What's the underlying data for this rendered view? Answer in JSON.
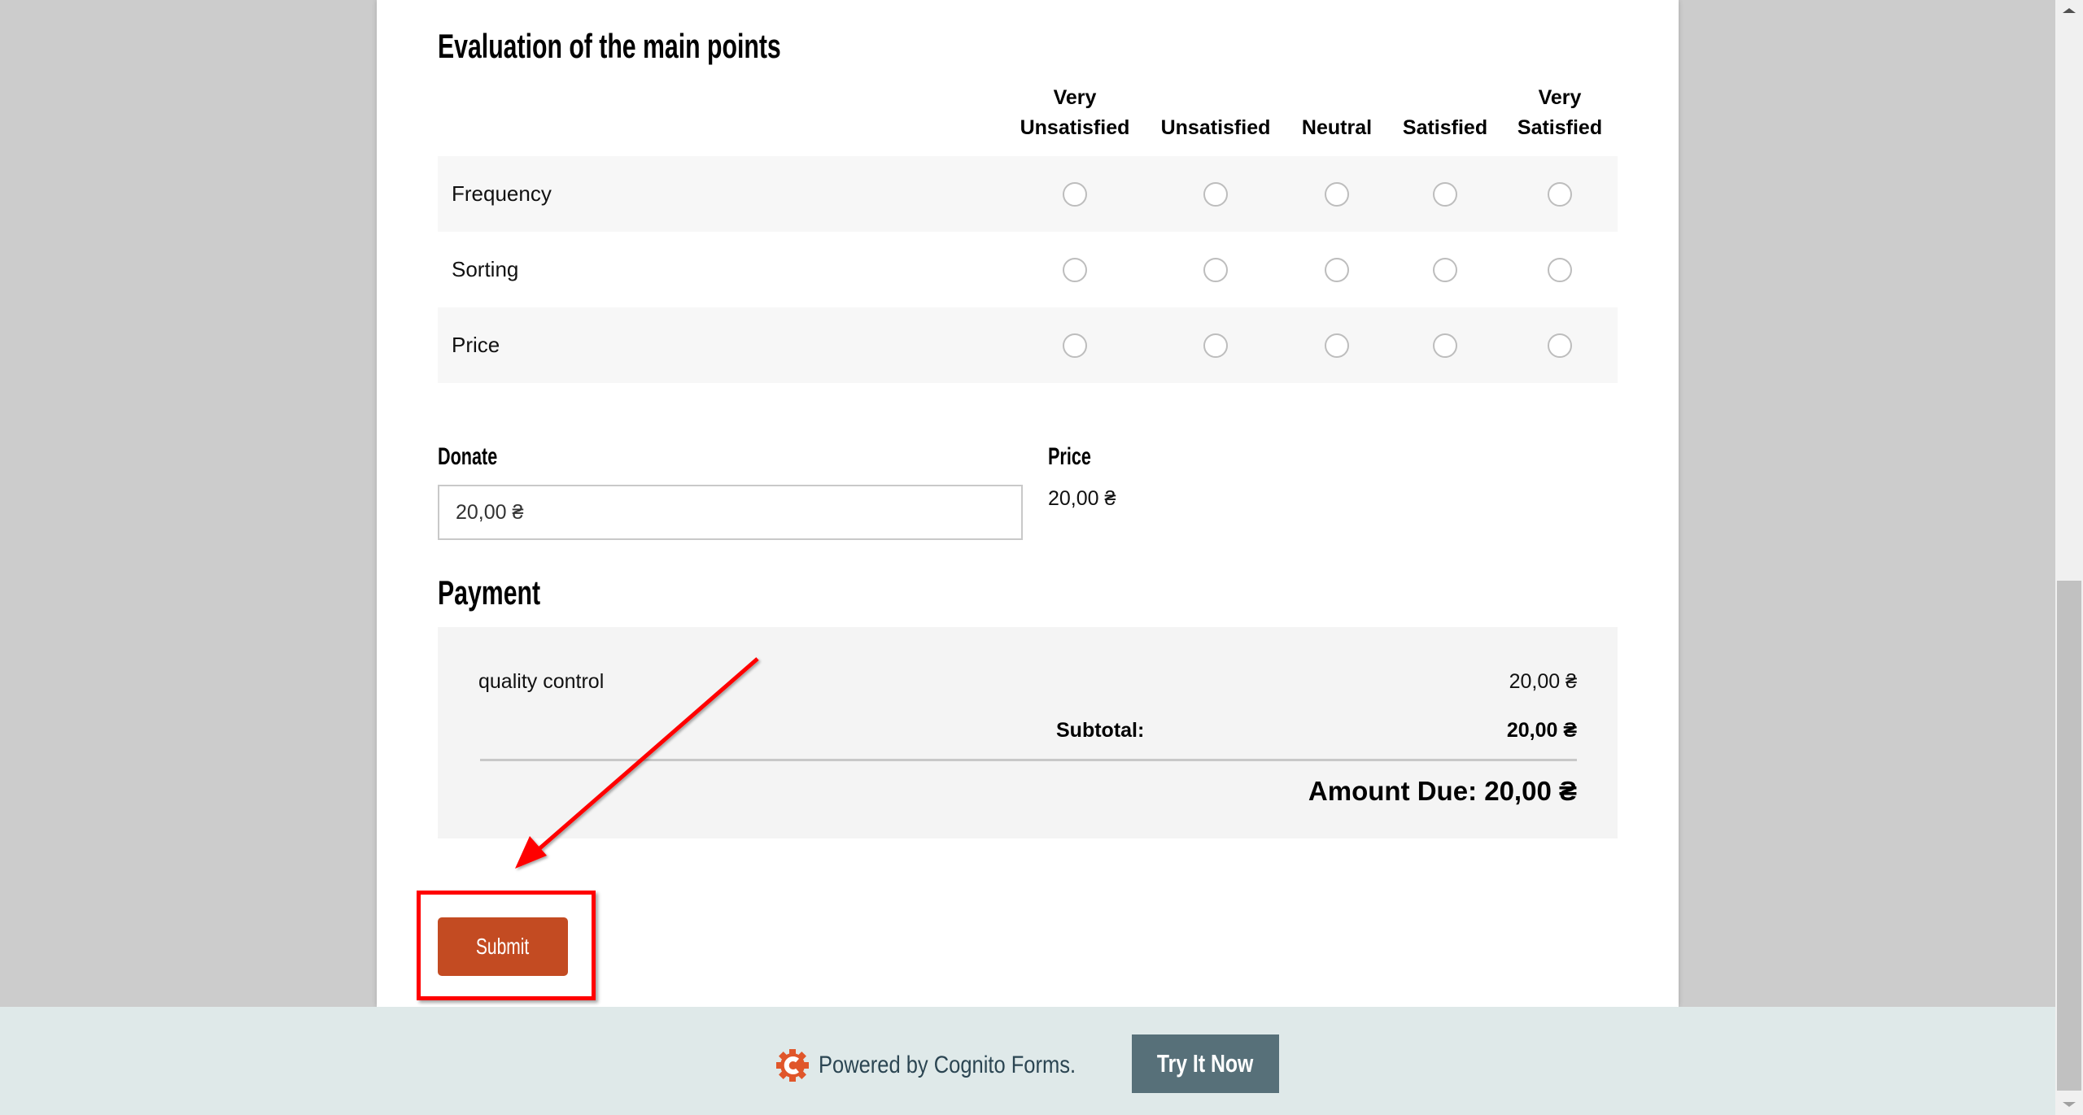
{
  "evaluation": {
    "title": "Evaluation of the main points",
    "columns": [
      {
        "line1": "Very",
        "line2": "Unsatisfied"
      },
      {
        "line1": "",
        "line2": "Unsatisfied"
      },
      {
        "line1": "",
        "line2": "Neutral"
      },
      {
        "line1": "",
        "line2": "Satisfied"
      },
      {
        "line1": "Very",
        "line2": "Satisfied"
      }
    ],
    "rows": [
      {
        "label": "Frequency",
        "selected": null
      },
      {
        "label": "Sorting",
        "selected": null
      },
      {
        "label": "Price",
        "selected": null
      }
    ]
  },
  "donate": {
    "label": "Donate",
    "value": "20,00 ₴"
  },
  "price": {
    "label": "Price",
    "value": "20,00 ₴"
  },
  "payment": {
    "title": "Payment",
    "items": [
      {
        "label": "quality control",
        "amount": "20,00 ₴"
      }
    ],
    "subtotal_label": "Subtotal:",
    "subtotal_amount": "20,00 ₴",
    "amount_due": "Amount Due: 20,00 ₴"
  },
  "submit": {
    "label": "Submit"
  },
  "annotation": {
    "highlight_color": "#ff0000",
    "target": "submit-button"
  },
  "footer": {
    "powered_text": "Powered by Cognito Forms.",
    "try_label": "Try It Now",
    "logo_icon": "cognito-gear-logo-icon"
  },
  "colors": {
    "submit_bg": "#c34b22",
    "try_bg": "#577079",
    "footer_bg": "#dfe9e9",
    "logo": "#e0562a"
  }
}
